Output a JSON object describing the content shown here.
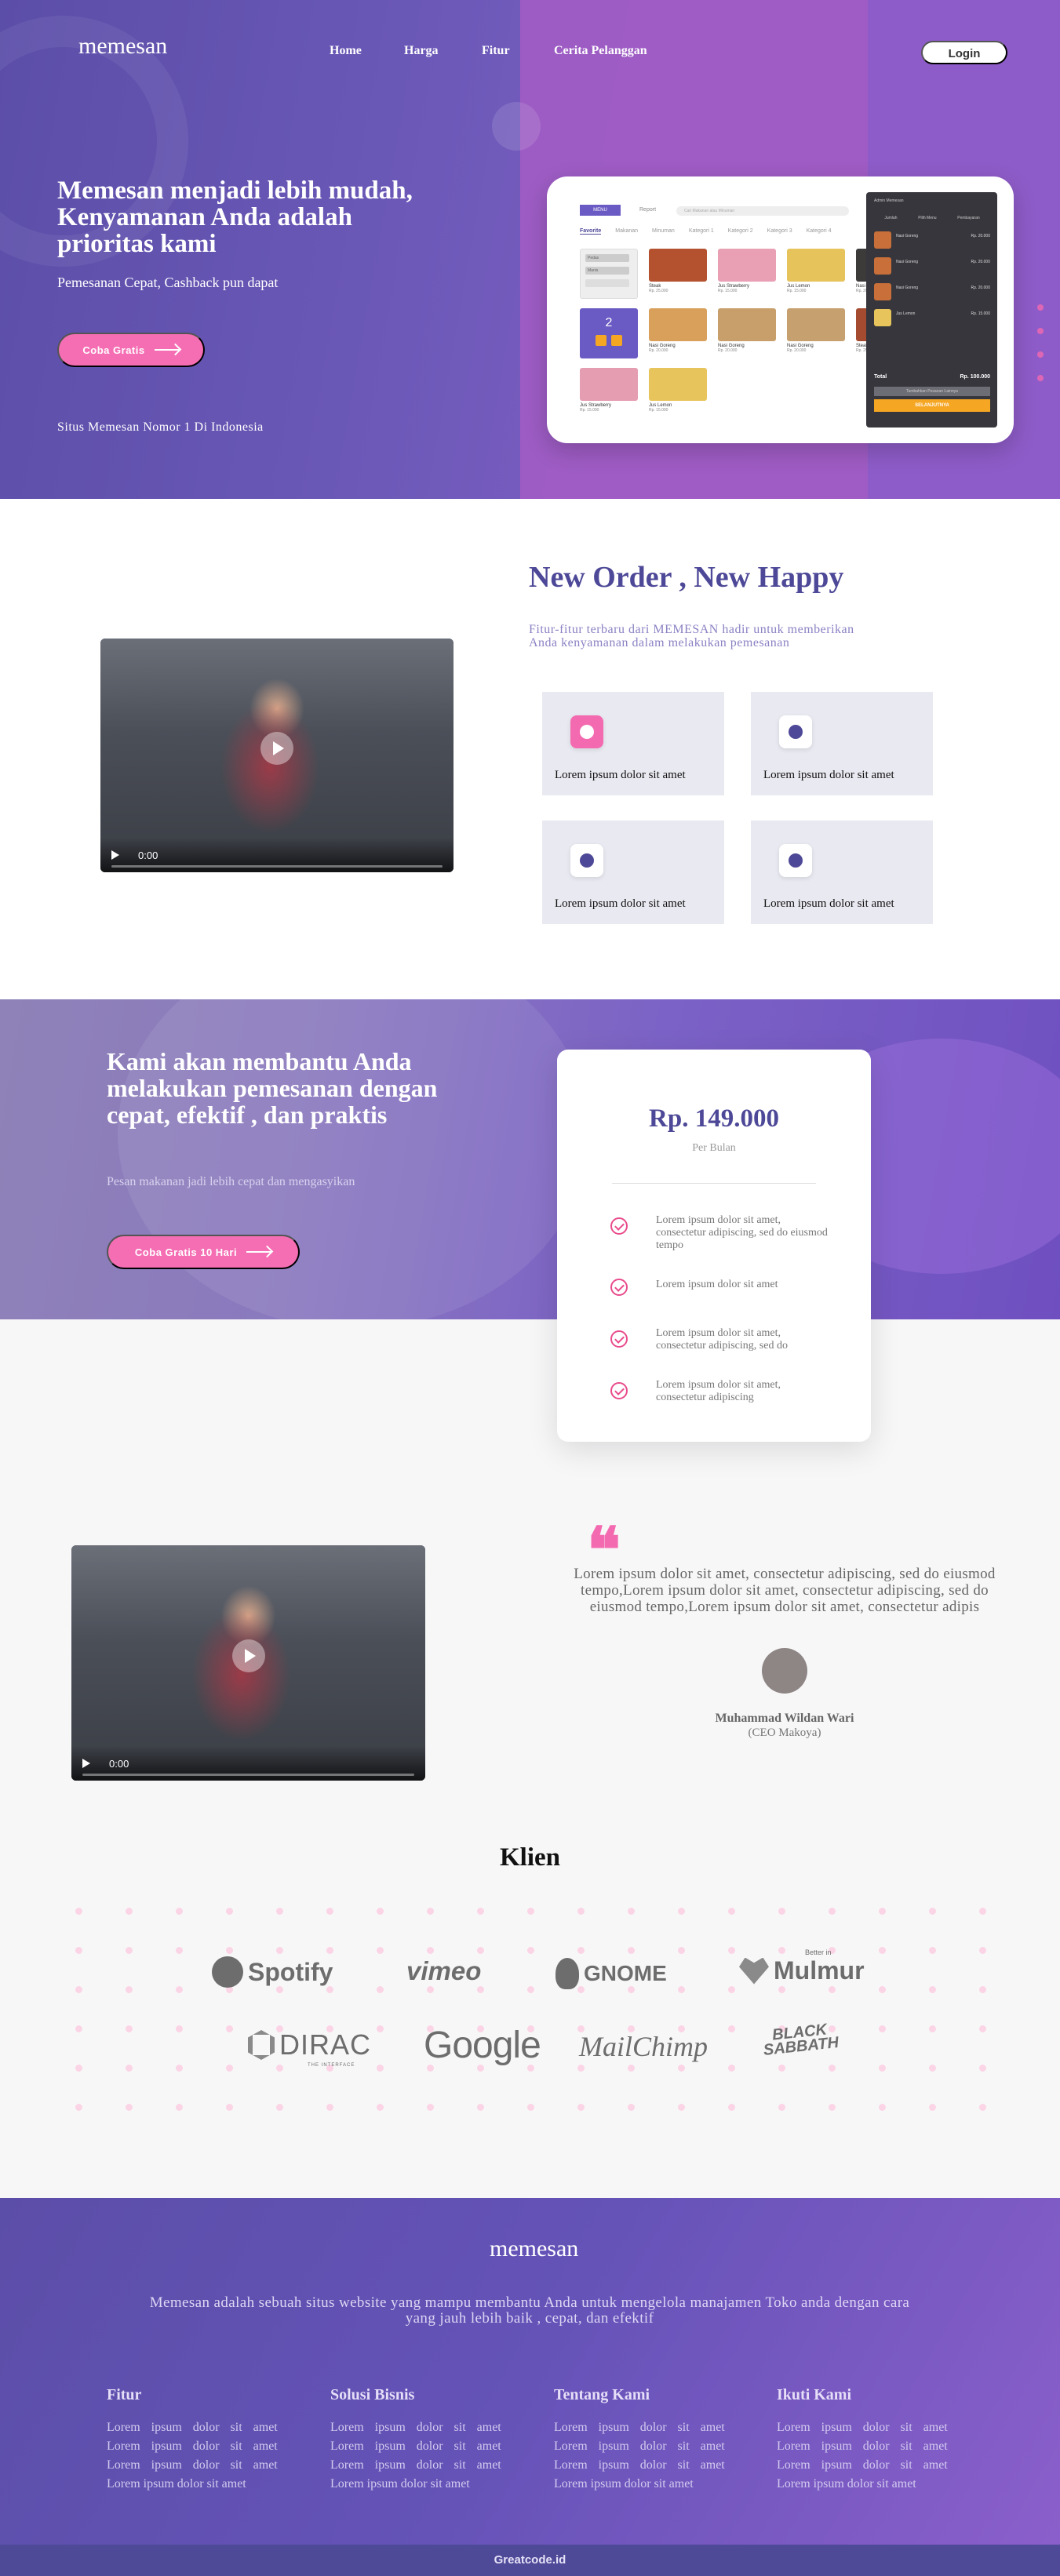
{
  "header": {
    "logo": "memesan",
    "nav": [
      "Home",
      "Harga",
      "Fitur",
      "Cerita Pelanggan"
    ],
    "login": "Login"
  },
  "hero": {
    "title": "Memesan menjadi lebih mudah, Kenyamanan Anda adalah prioritas kami",
    "subtitle": "Pemesanan Cepat, Cashback pun dapat",
    "cta": "Coba Gratis",
    "tagline": "Situs Memesan Nomor 1 Di Indonesia"
  },
  "mockup": {
    "menu": "MENU",
    "tab2": "Report",
    "search": "Cari Makanan atau Minuman",
    "categories": [
      "Favorite",
      "Makanan",
      "Minuman",
      "Kategori 1",
      "Kategori 2",
      "Kategori 3",
      "Kategori 4"
    ],
    "filters": [
      "Pedas",
      "Manis"
    ],
    "counter": "2",
    "items": [
      {
        "name": "Steak",
        "price": "Rp. 25.000",
        "color": "#b4512f"
      },
      {
        "name": "Jus Strawberry",
        "price": "Rp. 15.000",
        "color": "#e9a0b4"
      },
      {
        "name": "Jus Lemon",
        "price": "Rp. 15.000",
        "color": "#e7c35b"
      },
      {
        "name": "Nasi Goreng",
        "price": "Rp. 20.000",
        "color": "#3d3a3a"
      },
      {
        "name": "Nasi Goreng",
        "price": "Rp. 20.000",
        "color": "#d9a05b"
      },
      {
        "name": "Nasi Goreng",
        "price": "Rp. 20.000",
        "color": "#c89f6a"
      },
      {
        "name": "Nasi Goreng",
        "price": "Rp. 20.000",
        "color": "#c7a06f"
      },
      {
        "name": "Steak",
        "price": "Rp. 25.000",
        "color": "#a44b30"
      },
      {
        "name": "Jus Strawberry",
        "price": "Rp. 15.000",
        "color": "#e59db1"
      },
      {
        "name": "Jus Lemon",
        "price": "Rp. 15.000",
        "color": "#e8c55c"
      }
    ],
    "order": {
      "user": "Admin Memesan",
      "cols": [
        "Jumlah",
        "Pilih Menu",
        "Pembayaran"
      ],
      "rows": [
        {
          "name": "Nasi Goreng",
          "price": "Rp. 20.000"
        },
        {
          "name": "Nasi Goreng",
          "price": "Rp. 20.000"
        },
        {
          "name": "Nasi Goreng",
          "price": "Rp. 20.000"
        },
        {
          "name": "Jus Lemon",
          "price": "Rp. 15.000"
        }
      ],
      "total_label": "Total",
      "total": "Rp. 100.000",
      "btn1": "Tambahkan Pesanan Lainnya",
      "btn2": "SELANJUTNYA"
    }
  },
  "features": {
    "title": "New Order , New Happy",
    "subtitle": "Fitur-fitur terbaru dari MEMESAN hadir untuk memberikan Anda kenyamanan dalam melakukan pemesanan",
    "cards": [
      "Lorem ipsum dolor sit amet",
      "Lorem ipsum dolor sit amet",
      "Lorem ipsum dolor sit amet",
      "Lorem ipsum dolor sit amet"
    ],
    "video_time": "0:00"
  },
  "pricing": {
    "title": "Kami akan membantu Anda melakukan pemesanan dengan cepat, efektif , dan praktis",
    "subtitle": "Pesan makanan jadi lebih cepat dan mengasyikan",
    "cta": "Coba Gratis 10 Hari",
    "amount": "Rp. 149.000",
    "period": "Per Bulan",
    "features": [
      "Lorem ipsum dolor sit amet, consectetur adipiscing, sed do eiusmod tempo",
      "Lorem ipsum dolor sit amet",
      "Lorem ipsum dolor sit amet, consectetur adipiscing, sed do",
      "Lorem ipsum dolor sit amet, consectetur adipiscing"
    ]
  },
  "testimonial": {
    "quote": "Lorem ipsum dolor sit amet, consectetur adipiscing, sed do eiusmod tempo,Lorem ipsum dolor sit amet, consectetur adipiscing, sed do eiusmod tempo,Lorem ipsum dolor sit amet, consectetur adipis",
    "name": "Muhammad Wildan Wari",
    "role": "(CEO Makoya)",
    "video_time": "0:00"
  },
  "clients": {
    "title": "Klien",
    "logos": [
      "Spotify",
      "vimeo",
      "GNOME",
      "Mulmur",
      "DIRAC",
      "Google",
      "MailChimp",
      "BLACK SABBATH"
    ],
    "logo_notes": {
      "mulmur_top": "Better in",
      "dirac_sub": "THE INTERFACE"
    }
  },
  "footer": {
    "logo": "memesan",
    "description": "Memesan adalah sebuah situs website yang mampu membantu Anda untuk mengelola manajamen Toko anda dengan cara yang jauh lebih baik , cepat, dan efektif",
    "columns": [
      {
        "title": "Fitur",
        "links": [
          "Lorem ipsum dolor sit amet",
          "Lorem ipsum dolor sit amet",
          "Lorem ipsum dolor sit amet",
          "Lorem ipsum dolor sit amet"
        ]
      },
      {
        "title": "Solusi Bisnis",
        "links": [
          "Lorem ipsum dolor sit amet",
          "Lorem ipsum dolor sit amet",
          "Lorem ipsum dolor sit amet",
          "Lorem ipsum dolor sit amet"
        ]
      },
      {
        "title": "Tentang Kami",
        "links": [
          "Lorem ipsum dolor sit amet",
          "Lorem ipsum dolor sit amet",
          "Lorem ipsum dolor sit amet",
          "Lorem ipsum dolor sit amet"
        ]
      },
      {
        "title": "Ikuti Kami",
        "links": [
          "Lorem ipsum dolor sit amet",
          "Lorem ipsum dolor sit amet",
          "Lorem ipsum dolor sit amet",
          "Lorem ipsum dolor sit amet"
        ]
      }
    ],
    "copyright": "Greatcode.id"
  },
  "colors": {
    "primary": "#5b4ea8",
    "accent": "#f56eb4",
    "title": "#4d4897"
  }
}
